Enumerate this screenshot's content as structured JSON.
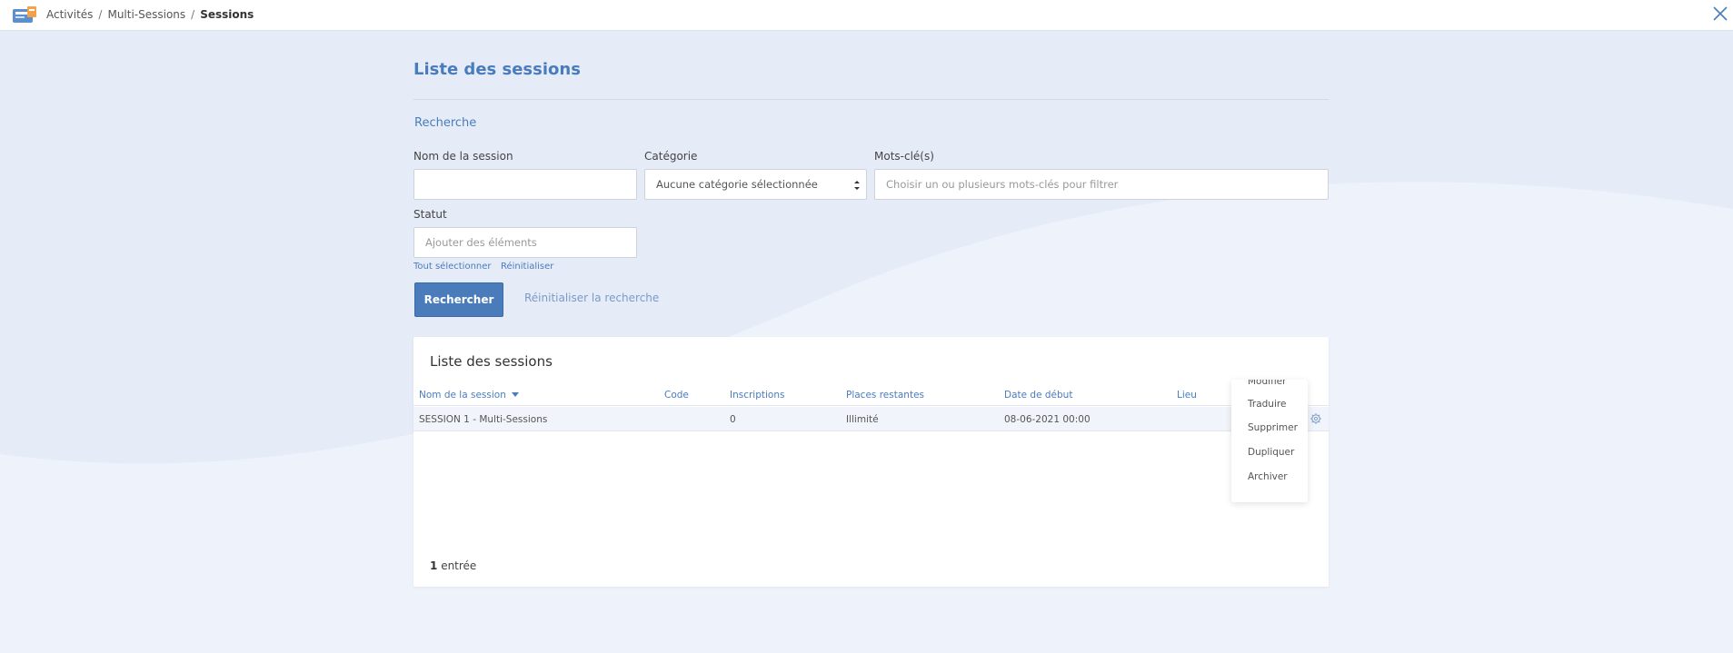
{
  "header": {
    "breadcrumb": [
      "Activités",
      "Multi-Sessions",
      "Sessions"
    ],
    "separator": "/"
  },
  "page": {
    "title": "Liste des sessions",
    "search_title": "Recherche"
  },
  "filters": {
    "session_name": {
      "label": "Nom de la session",
      "value": ""
    },
    "category": {
      "label": "Catégorie",
      "value": "Aucune catégorie sélectionnée"
    },
    "keywords": {
      "label": "Mots-clé(s)",
      "placeholder": "Choisir un ou plusieurs mots-clés pour filtrer"
    },
    "status": {
      "label": "Statut",
      "placeholder": "Ajouter des éléments"
    },
    "select_all": "Tout sélectionner",
    "reset": "Réinitialiser"
  },
  "actions": {
    "search": "Rechercher",
    "reset_search": "Réinitialiser la recherche"
  },
  "table": {
    "title": "Liste des sessions",
    "columns": [
      "Nom de la session",
      "Code",
      "Inscriptions",
      "Places restantes",
      "Date de début",
      "Lieu"
    ],
    "rows": [
      {
        "name": "SESSION 1 - Multi-Sessions",
        "code": "",
        "inscriptions": "0",
        "places": "Illimité",
        "date": "08-06-2021 00:00",
        "lieu": ""
      }
    ],
    "count_number": "1",
    "count_label": "entrée"
  },
  "row_menu": {
    "items": [
      "Modifier",
      "Traduire",
      "Supprimer",
      "Dupliquer",
      "Archiver"
    ]
  },
  "colors": {
    "accent": "#4a7cbc",
    "background": "#e6ecf7",
    "button": "#4a7cbc"
  },
  "icons": [
    "app-logo-icon",
    "close-icon",
    "sort-down-icon",
    "gear-icon",
    "select-arrows-icon"
  ]
}
